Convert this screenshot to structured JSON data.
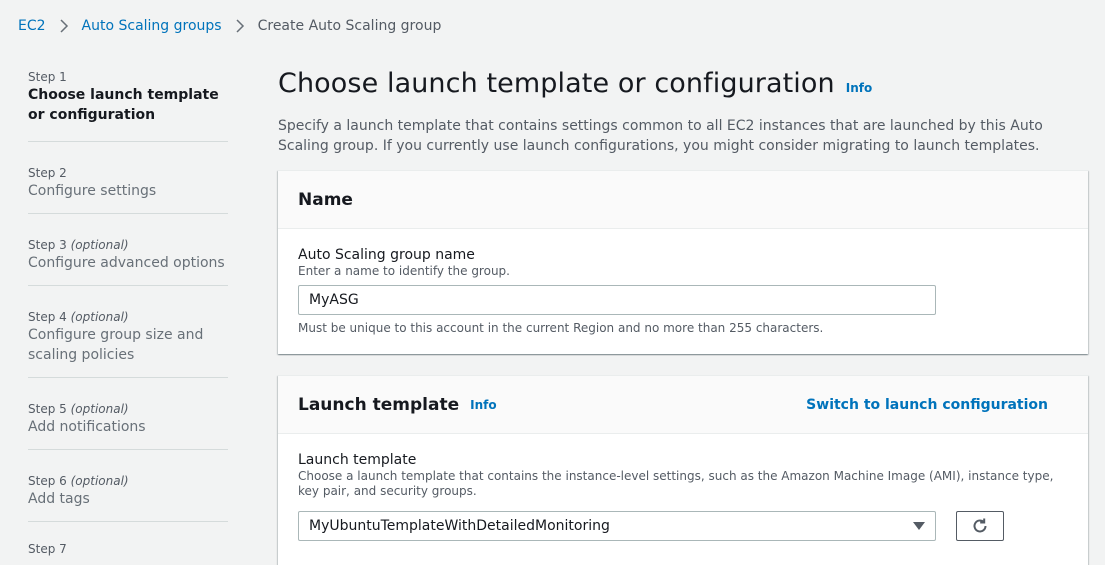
{
  "breadcrumb": {
    "items": [
      "EC2",
      "Auto Scaling groups"
    ],
    "current": "Create Auto Scaling group"
  },
  "wizard": {
    "steps": [
      {
        "number": "Step 1",
        "optional": "",
        "title": "Choose launch template or configuration",
        "active": true
      },
      {
        "number": "Step 2",
        "optional": "",
        "title": "Configure settings"
      },
      {
        "number": "Step 3",
        "optional": "(optional)",
        "title": "Configure advanced options"
      },
      {
        "number": "Step 4",
        "optional": "(optional)",
        "title": "Configure group size and scaling policies"
      },
      {
        "number": "Step 5",
        "optional": "(optional)",
        "title": "Add notifications"
      },
      {
        "number": "Step 6",
        "optional": "(optional)",
        "title": "Add tags"
      },
      {
        "number": "Step 7",
        "optional": "",
        "title": ""
      }
    ]
  },
  "main": {
    "title": "Choose launch template or configuration",
    "info": "Info",
    "description": "Specify a launch template that contains settings common to all EC2 instances that are launched by this Auto Scaling group. If you currently use launch configurations, you might consider migrating to launch templates."
  },
  "name_panel": {
    "header": "Name",
    "label": "Auto Scaling group name",
    "description": "Enter a name to identify the group.",
    "value": "MyASG",
    "constraint": "Must be unique to this account in the current Region and no more than 255 characters."
  },
  "launch_template_panel": {
    "header": "Launch template",
    "info": "Info",
    "switch_link": "Switch to launch configuration",
    "label": "Launch template",
    "description": "Choose a launch template that contains the instance-level settings, such as the Amazon Machine Image (AMI), instance type, key pair, and security groups.",
    "selected": "MyUbuntuTemplateWithDetailedMonitoring"
  },
  "icons": {
    "breadcrumb_separator": "chevron-right-icon",
    "select_caret": "caret-down-icon",
    "refresh": "refresh-icon"
  },
  "colors": {
    "link": "#0073bb",
    "background": "#f2f3f3",
    "panel_header": "#fafafa"
  }
}
